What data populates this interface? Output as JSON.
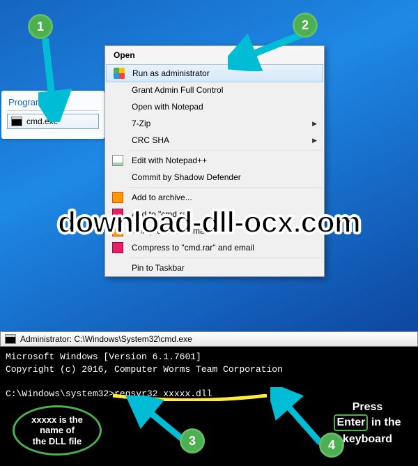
{
  "steps": {
    "one": "1",
    "two": "2",
    "three": "3",
    "four": "4"
  },
  "programs": {
    "header": "Programs (1)",
    "item": "cmd.exe"
  },
  "context_menu": {
    "header": "Open",
    "items": [
      {
        "label": "Run as administrator"
      },
      {
        "label": "Grant Admin Full Control"
      },
      {
        "label": "Open with Notepad"
      },
      {
        "label": "7-Zip",
        "submenu": true
      },
      {
        "label": "CRC SHA",
        "submenu": true
      },
      {
        "label": "Edit with Notepad++"
      },
      {
        "label": "Commit by Shadow Defender"
      },
      {
        "label": "Add to archive..."
      },
      {
        "label": "Add to \"cmd.rar\""
      },
      {
        "label": "Compress and email..."
      },
      {
        "label": "Compress to \"cmd.rar\" and email"
      },
      {
        "label": "Pin to Taskbar"
      }
    ]
  },
  "watermark": "download-dll-ocx.com",
  "cmd": {
    "title": "Administrator: C:\\Windows\\System32\\cmd.exe",
    "line1": "Microsoft Windows [Version 6.1.7601]",
    "line2": "Copyright (c) 2016, Computer Worms Team Corporation",
    "prompt": "C:\\Windows\\system32>regsvr32 xxxxx.dll"
  },
  "annotations": {
    "left_oval_l1": "xxxxx is the",
    "left_oval_l2": "name of",
    "left_oval_l3": "the DLL file",
    "right_press": "Press",
    "right_enter": "Enter",
    "right_in_the": "in the",
    "right_keyboard": "keyboard"
  }
}
